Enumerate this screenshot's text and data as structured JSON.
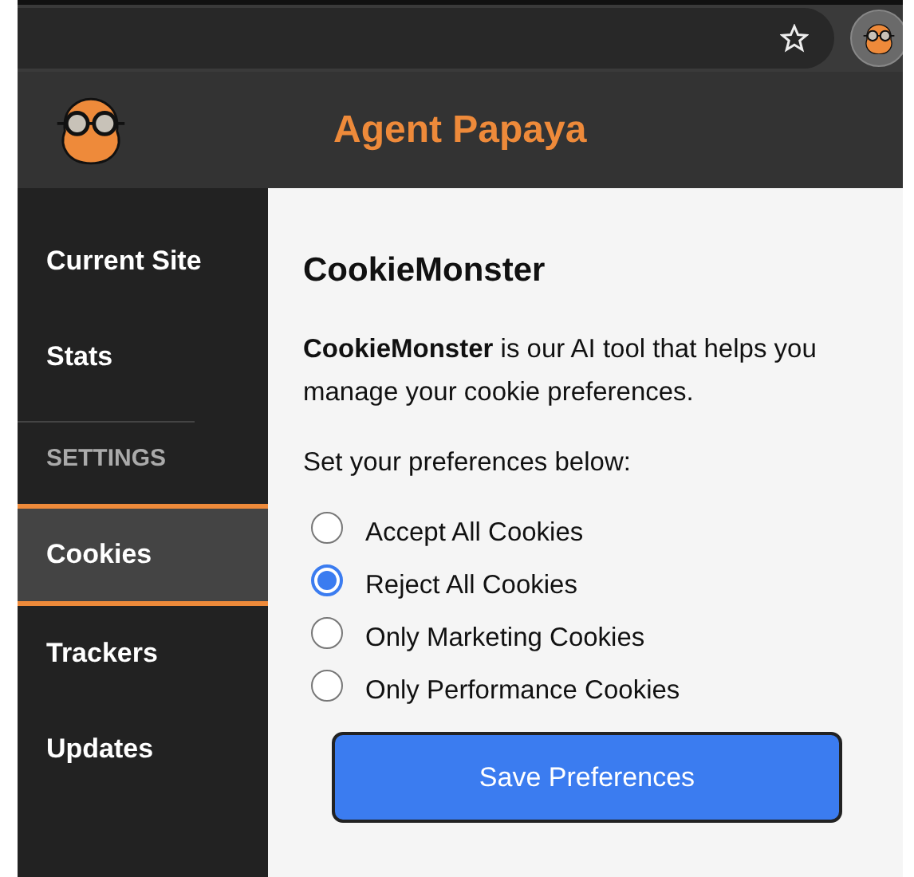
{
  "header": {
    "title": "Agent Papaya"
  },
  "sidebar": {
    "items": [
      {
        "kind": "link",
        "label": "Current Site",
        "selected": false
      },
      {
        "kind": "link",
        "label": "Stats",
        "selected": false
      },
      {
        "kind": "heading",
        "label": "SETTINGS"
      },
      {
        "kind": "link",
        "label": "Cookies",
        "selected": true
      },
      {
        "kind": "link",
        "label": "Trackers",
        "selected": false
      },
      {
        "kind": "link",
        "label": "Updates",
        "selected": false
      }
    ]
  },
  "content": {
    "title": "CookieMonster",
    "description": "**CookieMonster** is our AI tool that helps you manage your cookie preferences.",
    "prompt": "Set your preferences below:",
    "options": [
      {
        "label": "Accept All Cookies",
        "selected": false
      },
      {
        "label": "Reject All Cookies",
        "selected": true
      },
      {
        "label": "Only Marketing Cookies",
        "selected": false
      },
      {
        "label": "Only Performance Cookies",
        "selected": false
      }
    ],
    "button": "Save Preferences"
  }
}
